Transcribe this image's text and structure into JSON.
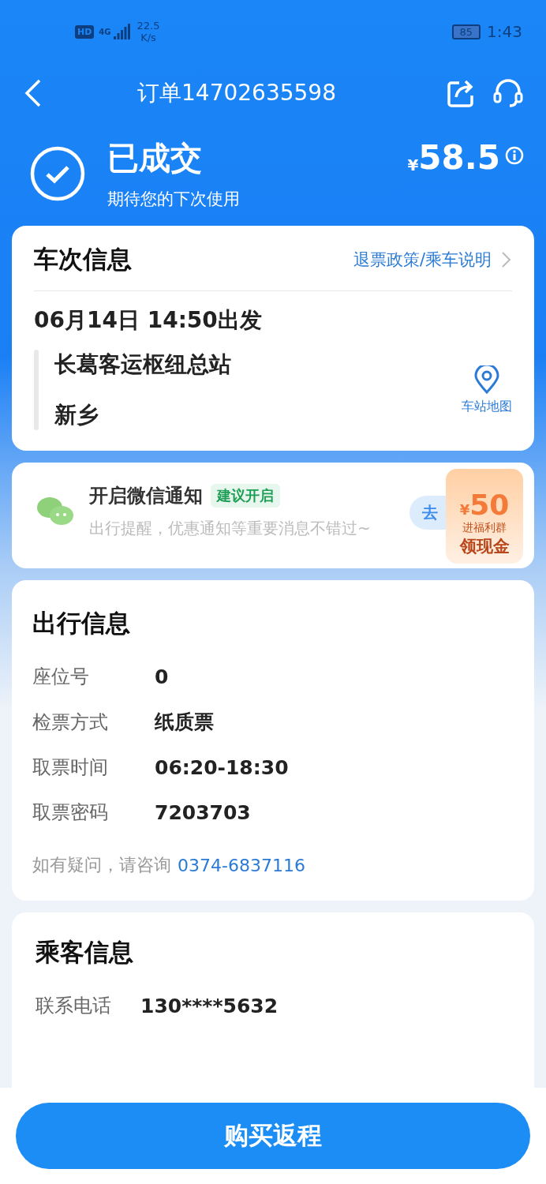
{
  "status_bar": {
    "hd": "HD",
    "network": "4G",
    "speed": "22.5",
    "speed_unit": "K/s",
    "battery": "85",
    "time": "1:43"
  },
  "nav": {
    "title": "订单14702635598"
  },
  "order": {
    "status": "已成交",
    "subtitle": "期待您的下次使用",
    "currency": "¥",
    "price": "58.5"
  },
  "trip_card": {
    "title": "车次信息",
    "link": "退票政策/乘车说明",
    "departure": "06月14日 14:50出发",
    "from": "长葛客运枢纽总站",
    "to": "新乡",
    "map_label": "车站地图"
  },
  "notify_card": {
    "title": "开启微信通知",
    "tag": "建议开启",
    "desc": "出行提醒，优惠通知等重要消息不错过~",
    "button": "去",
    "promo": {
      "currency": "¥",
      "amount": "50",
      "line1": "进福利群",
      "line2": "领现金"
    }
  },
  "travel_card": {
    "title": "出行信息",
    "rows": [
      {
        "label": "座位号",
        "value": "0"
      },
      {
        "label": "检票方式",
        "value": "纸质票"
      },
      {
        "label": "取票时间",
        "value": "06:20-18:30"
      },
      {
        "label": "取票密码",
        "value": "7203703"
      }
    ],
    "help": "如有疑问，请咨询",
    "phone": "0374-6837116"
  },
  "passenger_card": {
    "title": "乘客信息",
    "rows": [
      {
        "label": "联系电话",
        "value": "130****5632"
      }
    ]
  },
  "footer": {
    "button": "购买返程"
  }
}
